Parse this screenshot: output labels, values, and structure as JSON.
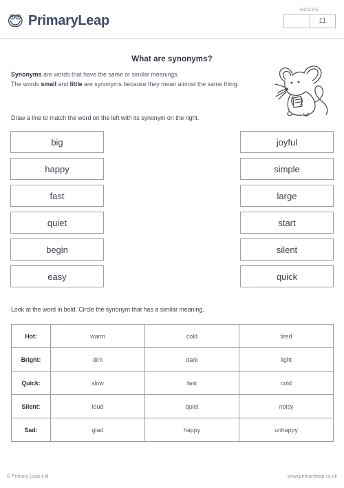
{
  "header": {
    "logo_text": "PrimaryLeap",
    "logo_icon": "frog-icon",
    "score_label": "SCORE",
    "score_blank": "",
    "score_value": "11"
  },
  "worksheet": {
    "title": "What are synonyms?",
    "intro": {
      "bold_1": "Synonyms",
      "text_1": " are words that have the same or similar meanings.",
      "text_2": "The words ",
      "bold_2": "small",
      "text_3": " and ",
      "bold_3": "little",
      "text_4": " are synonyms because they mean almost the same thing."
    },
    "illustration": "mouse-illustration"
  },
  "activity_1": {
    "instruction": "Draw a line to match the word on the left with its synonym on the right.",
    "left_words": [
      "big",
      "happy",
      "fast",
      "quiet",
      "begin",
      "easy"
    ],
    "right_words": [
      "joyful",
      "simple",
      "large",
      "start",
      "silent",
      "quick"
    ]
  },
  "activity_2": {
    "instruction": "Look at the word in bold. Circle the synonym that has a similar meaning.",
    "rows": [
      {
        "word": "Hot:",
        "options": [
          "warm",
          "cold",
          "tired"
        ]
      },
      {
        "word": "Bright:",
        "options": [
          "dim",
          "dark",
          "light"
        ]
      },
      {
        "word": "Quick:",
        "options": [
          "slow",
          "fast",
          "cold"
        ]
      },
      {
        "word": "Silent:",
        "options": [
          "loud",
          "quiet",
          "noisy"
        ]
      },
      {
        "word": "Sad:",
        "options": [
          "glad",
          "happy",
          "unhappy"
        ]
      }
    ]
  },
  "footer": {
    "copyright": "© Primary Leap Ltd.",
    "website": "www.primaryleap.co.uk"
  },
  "colors": {
    "brand": "#3c4a63",
    "text": "#55596a",
    "border": "#9a9da6",
    "rule": "#d6d7de"
  }
}
